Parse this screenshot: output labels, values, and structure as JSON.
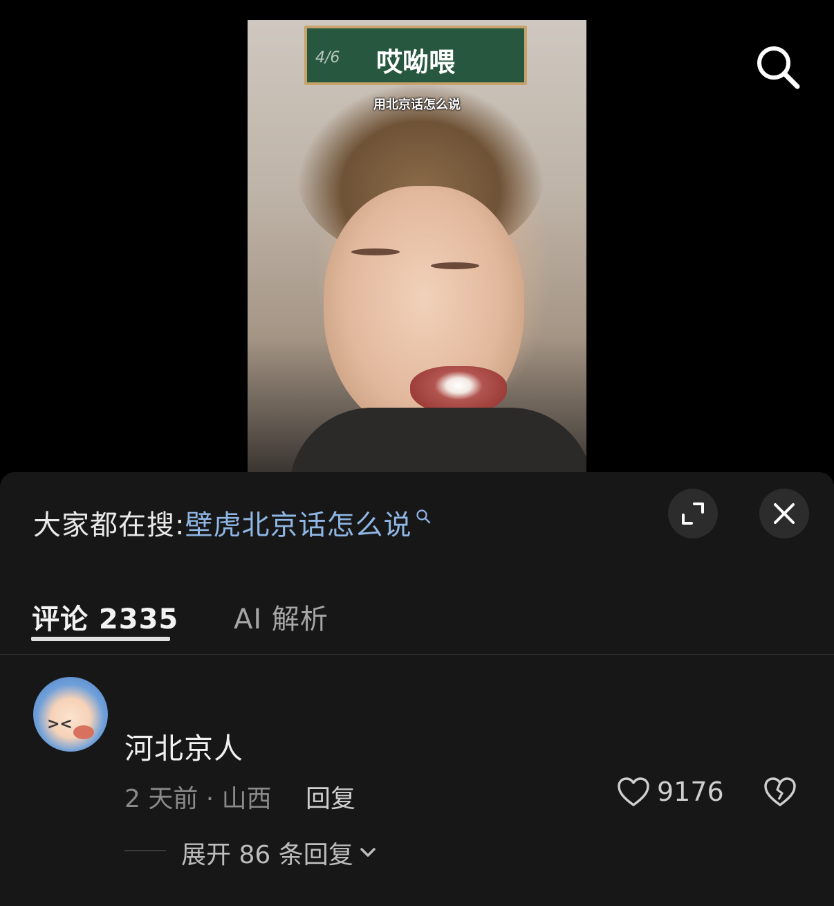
{
  "video": {
    "page_indicator": "4/6",
    "board_title": "哎呦喂",
    "subtitle": "用北京话怎么说"
  },
  "icons": {
    "top_search": "search-icon",
    "suggest_search": "search-icon",
    "expand": "expand-icon",
    "close": "close-icon",
    "like": "heart-icon",
    "dislike": "broken-heart-icon",
    "chevron": "chevron-down-icon"
  },
  "suggest": {
    "label": "大家都在搜:",
    "query": "壁虎北京话怎么说"
  },
  "tabs": [
    {
      "label": "评论 2335",
      "active": true
    },
    {
      "label": "AI 解析",
      "active": false
    }
  ],
  "comment": {
    "text": "河北京人",
    "time_location": "2 天前 · 山西",
    "reply_label": "回复",
    "likes": "9176",
    "expand_label": "展开 86 条回复"
  },
  "colors": {
    "sheet_bg": "#171717",
    "link_blue": "#8fb6e4"
  }
}
